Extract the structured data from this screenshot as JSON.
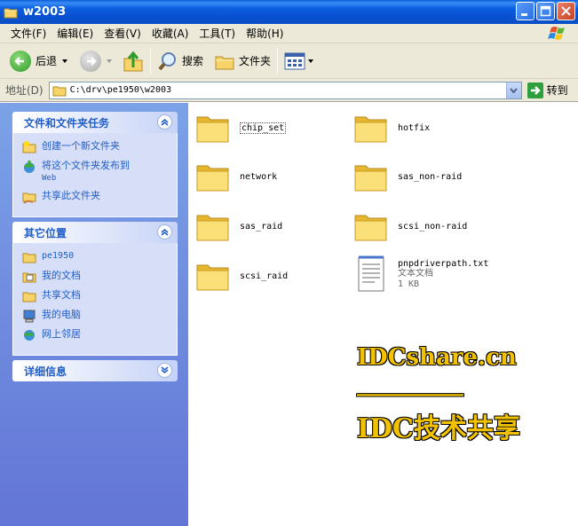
{
  "window": {
    "title": "w2003"
  },
  "menu": {
    "items": [
      "文件(F)",
      "编辑(E)",
      "查看(V)",
      "收藏(A)",
      "工具(T)",
      "帮助(H)"
    ]
  },
  "toolbar": {
    "back_label": "后退",
    "search_label": "搜索",
    "folders_label": "文件夹"
  },
  "address": {
    "label": "地址(D)",
    "value": "C:\\drv\\pe1950\\w2003",
    "go_label": "转到"
  },
  "tasks_panel": {
    "title": "文件和文件夹任务",
    "items": [
      {
        "label": "创建一个新文件夹",
        "icon": "new-folder-icon"
      },
      {
        "label": "将这个文件夹发布到",
        "label2": "Web",
        "icon": "publish-web-icon"
      },
      {
        "label": "共享此文件夹",
        "icon": "share-folder-icon"
      }
    ]
  },
  "places_panel": {
    "title": "其它位置",
    "items": [
      {
        "label": "pe1950",
        "icon": "folder-icon"
      },
      {
        "label": "我的文档",
        "icon": "my-documents-icon"
      },
      {
        "label": "共享文档",
        "icon": "shared-documents-icon"
      },
      {
        "label": "我的电脑",
        "icon": "my-computer-icon"
      },
      {
        "label": "网上邻居",
        "icon": "network-places-icon"
      }
    ]
  },
  "details_panel": {
    "title": "详细信息"
  },
  "files": [
    {
      "name": "chip_set",
      "type": "folder"
    },
    {
      "name": "hotfix",
      "type": "folder"
    },
    {
      "name": "network",
      "type": "folder"
    },
    {
      "name": "sas_non-raid",
      "type": "folder"
    },
    {
      "name": "sas_raid",
      "type": "folder"
    },
    {
      "name": "scsi_non-raid",
      "type": "folder"
    },
    {
      "name": "scsi_raid",
      "type": "folder"
    },
    {
      "name": "pnpdriverpath.txt",
      "type": "text",
      "kind": "文本文档",
      "size": "1 KB"
    }
  ],
  "watermark": {
    "line1": "IDCshare.cn",
    "line2": "__________",
    "line3": "IDC技术共享"
  },
  "colors": {
    "titlebar": "#0b5fe0",
    "pane": "#7ba2e7",
    "link": "#215dc6",
    "watermark": "#f2c200"
  }
}
